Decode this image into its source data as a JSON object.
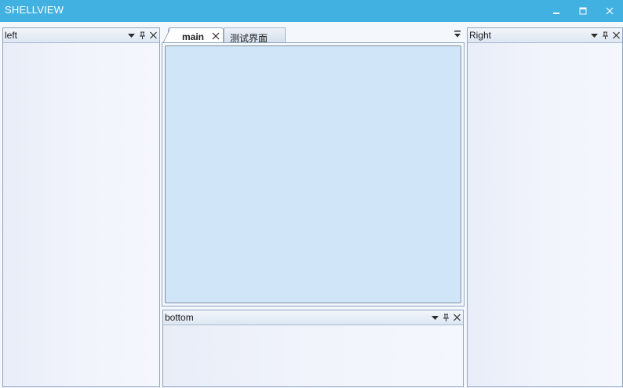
{
  "window": {
    "title": "SHELLVIEW",
    "controls": [
      "minimize-icon",
      "maximize-icon",
      "close-icon"
    ]
  },
  "panels": {
    "left": {
      "title": "left",
      "buttons": [
        "dropdown-icon",
        "pin-icon",
        "close-icon"
      ]
    },
    "right": {
      "title": "Right",
      "buttons": [
        "dropdown-icon",
        "pin-icon",
        "close-icon"
      ]
    },
    "bottom": {
      "title": "bottom",
      "buttons": [
        "dropdown-icon",
        "pin-icon",
        "close-icon"
      ]
    }
  },
  "document": {
    "tabs": [
      {
        "label": "main",
        "active": true
      },
      {
        "label": "测试界面",
        "active": false
      }
    ]
  },
  "colors": {
    "titlebar": "#41b1e1",
    "panel_border": "#8da3c1",
    "doc_content": "#d1e5f8"
  }
}
